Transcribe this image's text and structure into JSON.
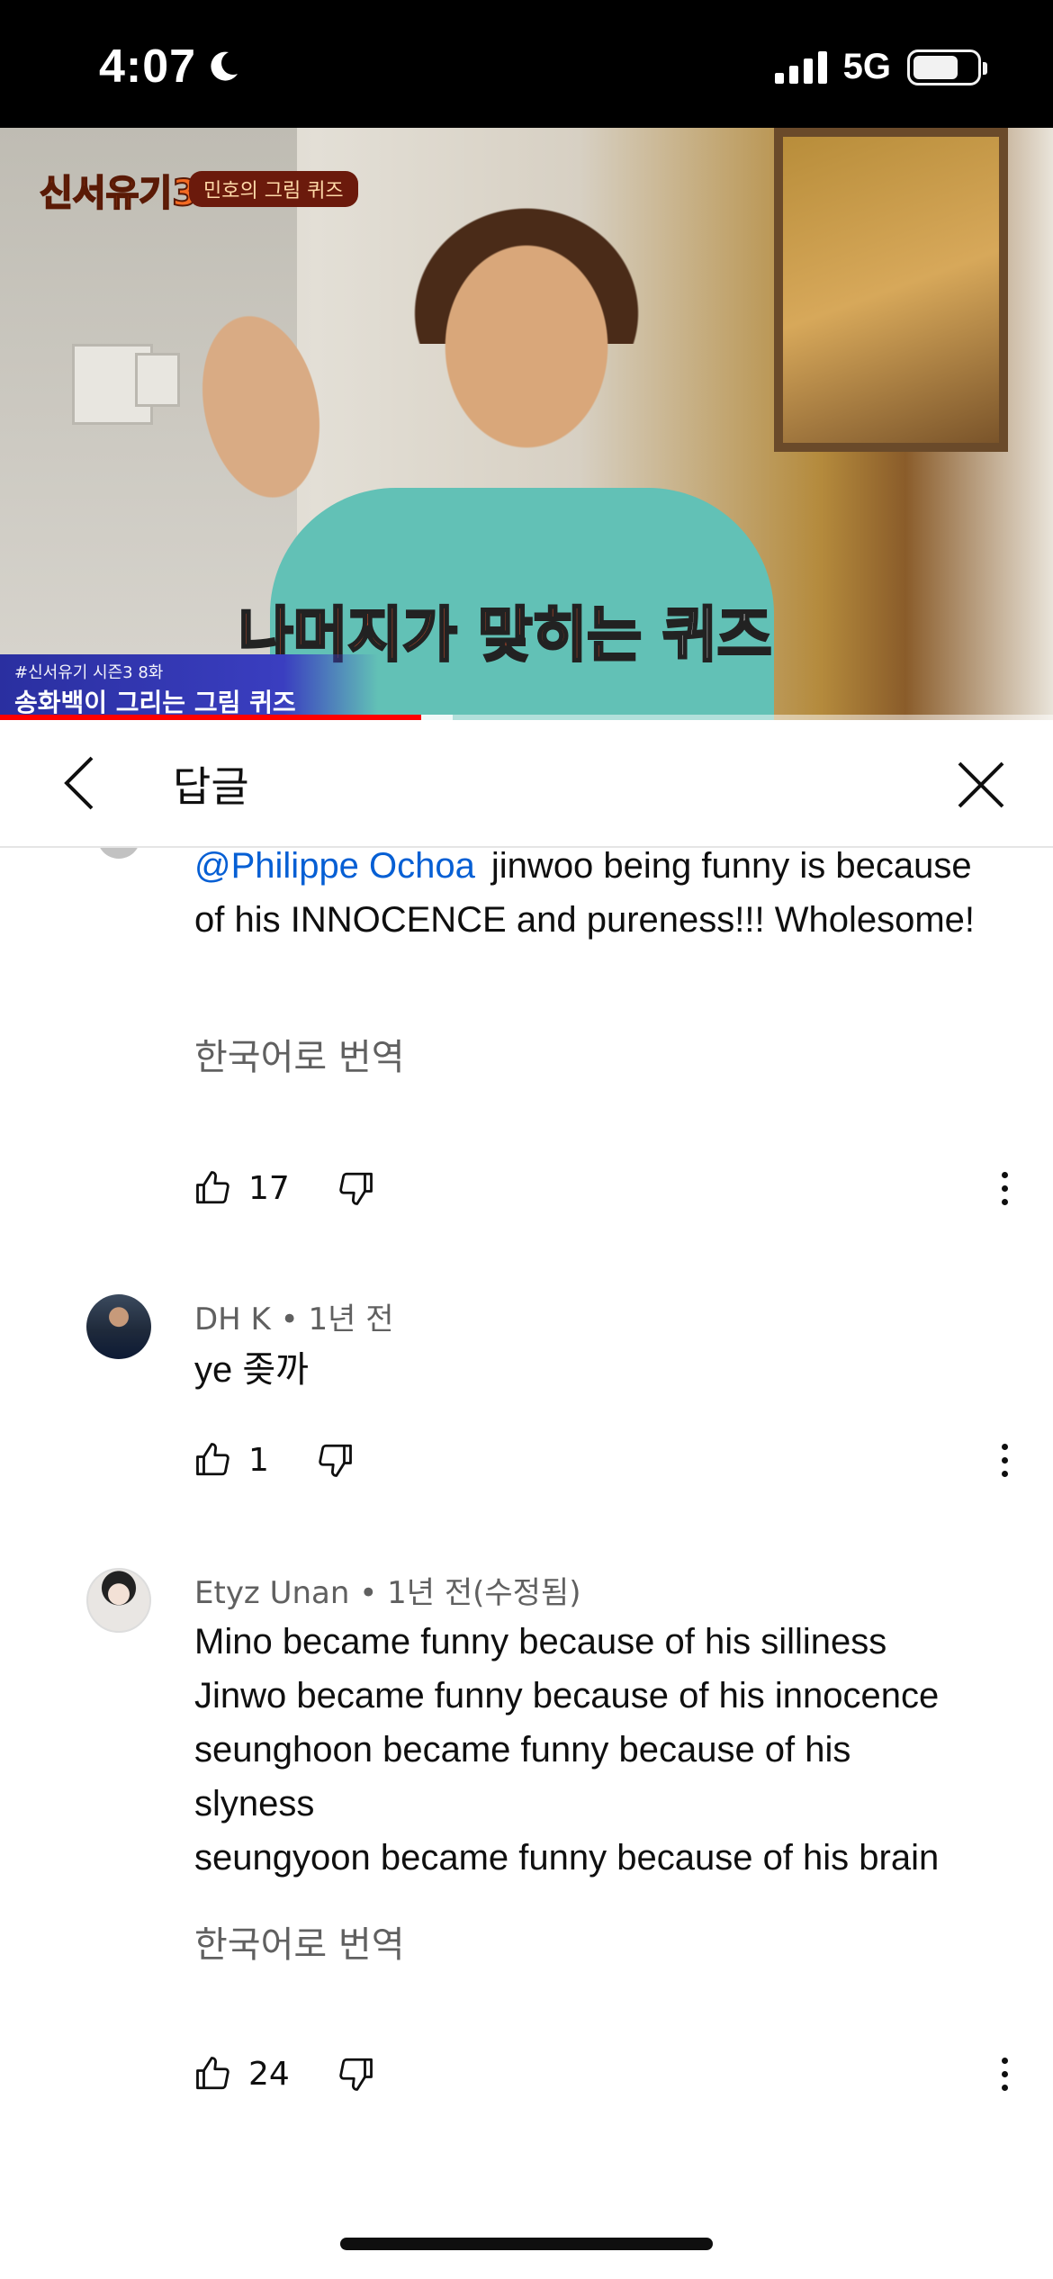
{
  "status_bar": {
    "time": "4:07",
    "network": "5G"
  },
  "video": {
    "show_logo": "신서유기3",
    "show_tag": "민호의 그림 퀴즈",
    "caption_part1": "나머지가 맞히는",
    "caption_part2": "퀴즈",
    "lower_third_line1": "#신서유기 시즌3 8화",
    "lower_third_line2": "송화백이 그리는 그림 퀴즈",
    "progress": 0.4,
    "buffered": 0.43
  },
  "header": {
    "title": "답글"
  },
  "comments": [
    {
      "mention": "@Philippe Ochoa",
      "text": "jinwoo being funny is because of his INNOCENCE and pureness!!! Wholesome!",
      "translate_label": "한국어로 번역",
      "likes": "17"
    },
    {
      "author": "DH K",
      "time": "1년 전",
      "text": "ye 좆까",
      "likes": "1"
    },
    {
      "author": "Etyz Unan",
      "time": "1년 전(수정됨)",
      "lines": [
        "Mino became funny because of his silliness",
        "Jinwo became funny because of his innocence",
        "seunghoon became funny because of his",
        "slyness",
        "seungyoon became funny because of his brain"
      ],
      "translate_label": "한국어로 번역",
      "likes": "24"
    }
  ],
  "separator": "•",
  "icons": {
    "back": "chevron-left-icon",
    "close": "close-icon",
    "like": "thumbs-up-icon",
    "dislike": "thumbs-down-icon",
    "more": "more-vertical-icon",
    "moon": "moon-icon",
    "signal": "cellular-signal-icon",
    "battery": "battery-icon"
  },
  "colors": {
    "mention": "#065fd4",
    "secondary_text": "#606060",
    "progress": "#ff0000"
  }
}
